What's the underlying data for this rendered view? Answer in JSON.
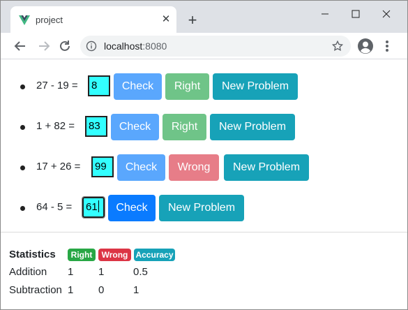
{
  "browser": {
    "tab_title": "project",
    "url_host": "localhost",
    "url_port": ":8080"
  },
  "problems": [
    {
      "expression": "27 - 19 =",
      "answer": "8",
      "check_label": "Check",
      "result_label": "Right",
      "result": "right",
      "new_label": "New Problem"
    },
    {
      "expression": "1 + 82 =",
      "answer": "83",
      "check_label": "Check",
      "result_label": "Right",
      "result": "right",
      "new_label": "New Problem"
    },
    {
      "expression": "17 + 26 =",
      "answer": "99",
      "check_label": "Check",
      "result_label": "Wrong",
      "result": "wrong",
      "new_label": "New Problem"
    },
    {
      "expression": "64 - 5 =",
      "answer": "61",
      "check_label": "Check",
      "result_label": "",
      "result": "none",
      "new_label": "New Problem"
    }
  ],
  "statistics": {
    "title": "Statistics",
    "badges": {
      "right": "Right",
      "wrong": "Wrong",
      "accuracy": "Accuracy"
    },
    "rows": [
      {
        "label": "Addition",
        "right": "1",
        "wrong": "1",
        "accuracy": "0.5"
      },
      {
        "label": "Subtraction",
        "right": "1",
        "wrong": "0",
        "accuracy": "1"
      }
    ]
  },
  "colors": {
    "check": "#5aa7fd",
    "check_active": "#0a7bff",
    "right": "#6fc488",
    "wrong": "#e77d88",
    "new_problem": "#17a2b8",
    "answer_bg": "#33ffff"
  }
}
